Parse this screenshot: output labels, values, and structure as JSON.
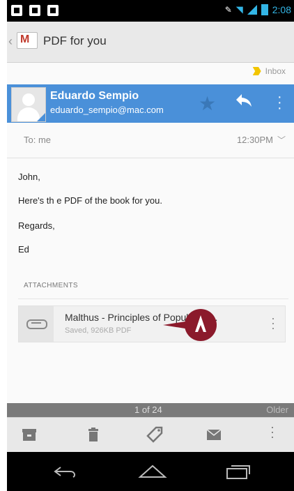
{
  "status_bar": {
    "time": "2:08",
    "icons": [
      "notification-icon",
      "notification-icon",
      "notification-icon",
      "mute-icon",
      "wifi-icon",
      "signal-icon",
      "battery-icon"
    ]
  },
  "action_bar": {
    "subject": "PDF for you",
    "app_icon": "gmail-icon"
  },
  "label": {
    "text": "Inbox",
    "color": "#f2c500"
  },
  "sender": {
    "name": "Eduardo Sempio",
    "email": "eduardo_sempio@mac.com",
    "color": "#4a90d9"
  },
  "recipient": {
    "to": "To: me",
    "time": "12:30PM"
  },
  "message": {
    "greeting": "John,",
    "body": "Here's th e PDF of the book for you.",
    "signoff": "Regards,",
    "signature": "Ed"
  },
  "attachments": {
    "header": "ATTACHMENTS",
    "items": [
      {
        "name": "Malthus - Principles of Population...",
        "meta": "Saved, 926KB PDF"
      }
    ]
  },
  "pager": {
    "position": "1 of 24",
    "older": "Older"
  },
  "toolbar": {
    "icons": [
      "archive-icon",
      "delete-icon",
      "label-icon",
      "mark-unread-icon",
      "overflow-icon"
    ]
  },
  "nav_bar": {
    "icons": [
      "back-icon",
      "home-icon",
      "recents-icon"
    ]
  }
}
